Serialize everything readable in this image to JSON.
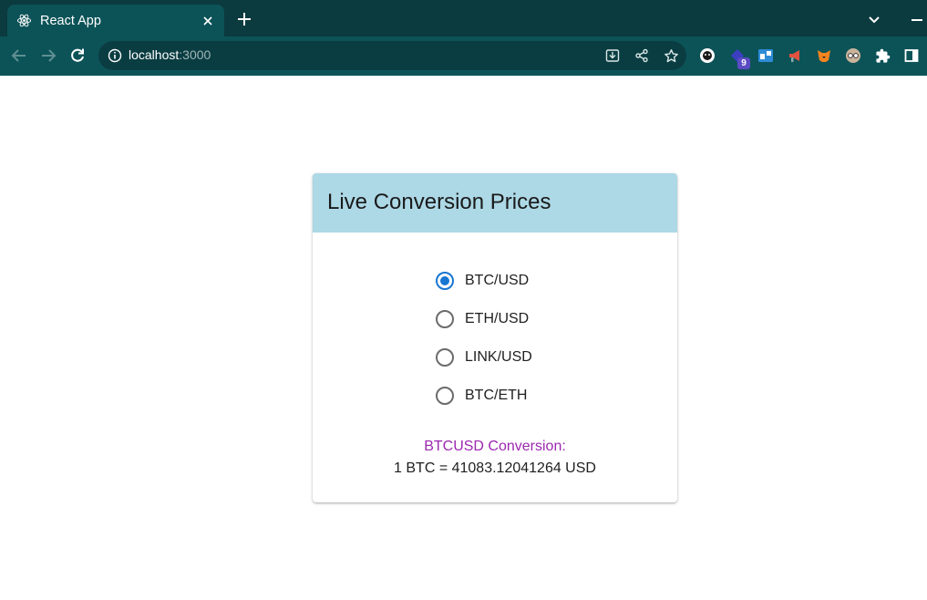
{
  "browser": {
    "tab_title": "React App",
    "url_host": "localhost",
    "url_port": ":3000",
    "extension_badge": "9"
  },
  "card": {
    "title": "Live Conversion Prices",
    "header_color": "#add8e6",
    "selected": "BTC/USD",
    "options": [
      {
        "label": "BTC/USD",
        "checked": true
      },
      {
        "label": "ETH/USD",
        "checked": false
      },
      {
        "label": "LINK/USD",
        "checked": false
      },
      {
        "label": "BTC/ETH",
        "checked": false
      }
    ],
    "conversion_title": "BTCUSD Conversion:",
    "conversion_value": "1 BTC = 41083.12041264 USD",
    "accent_color": "#1976d2",
    "conversion_title_color": "#9c27b0"
  }
}
